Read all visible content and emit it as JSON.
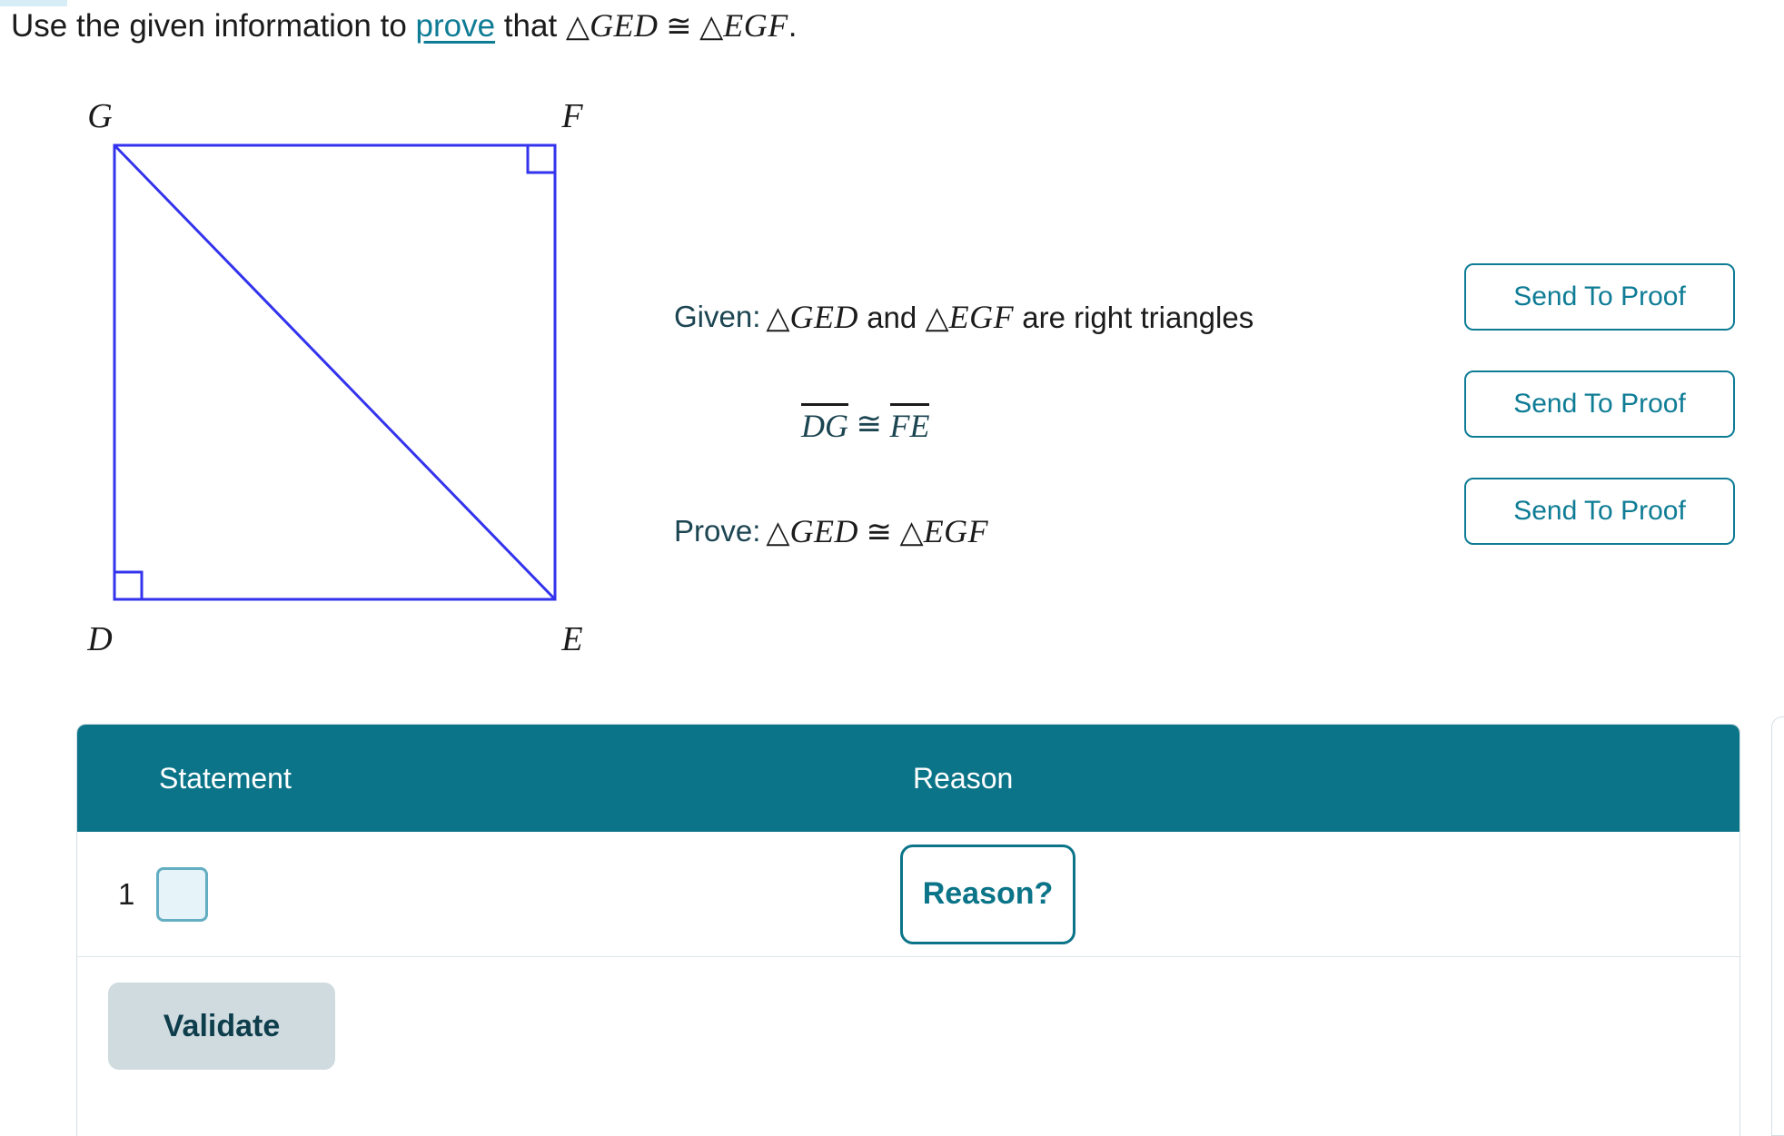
{
  "prompt": {
    "before_link": "Use the given information to ",
    "link": "prove",
    "after_link": " that ",
    "triangle_symbol": "△",
    "first_triangle": "GED",
    "congruent_symbol": "≅",
    "second_triangle": "EGF",
    "period": "."
  },
  "figure": {
    "name": "rectangle-with-diagonal",
    "vertices": [
      {
        "label": "G",
        "position": "top-left"
      },
      {
        "label": "F",
        "position": "top-right"
      },
      {
        "label": "E",
        "position": "bottom-right"
      },
      {
        "label": "D",
        "position": "bottom-left"
      }
    ],
    "diagonal": "G to E",
    "right_angle_marks": [
      "F",
      "D"
    ],
    "stroke_color": "#3333ee",
    "label_color": "#1a1a1a"
  },
  "given_prove": {
    "rows": [
      {
        "label": "Given:",
        "triangle_symbol": "△",
        "first_triangle": "GED",
        "conjunction": " and ",
        "second_triangle": "EGF",
        "tail": " are right triangles",
        "type": "triangles",
        "button": "Send To Proof"
      },
      {
        "label": "",
        "segment_a": "DG",
        "congruent_symbol": "≅",
        "segment_b": "FE",
        "type": "segments",
        "button": "Send To Proof"
      },
      {
        "label": "Prove:",
        "triangle_symbol": "△",
        "first_triangle": "GED",
        "congruent_symbol": "≅",
        "second_triangle": "EGF",
        "type": "congruence",
        "button": "Send To Proof"
      }
    ]
  },
  "proof_table": {
    "columns": [
      "Statement",
      "Reason"
    ],
    "rows": [
      {
        "number": "1",
        "statement_value": "",
        "statement_placeholder": "",
        "reason_label": "Reason?"
      }
    ],
    "validate_label": "Validate"
  },
  "colors": {
    "teal_header": "#0b7488",
    "teal_accent": "#0e7c95",
    "dark_slate": "#1c4552",
    "figure_blue": "#3333ee",
    "input_fill": "#e6f3f8",
    "input_border": "#63aec2",
    "validate_bg": "#cfdbdf",
    "validate_text": "#0e3d4c"
  }
}
